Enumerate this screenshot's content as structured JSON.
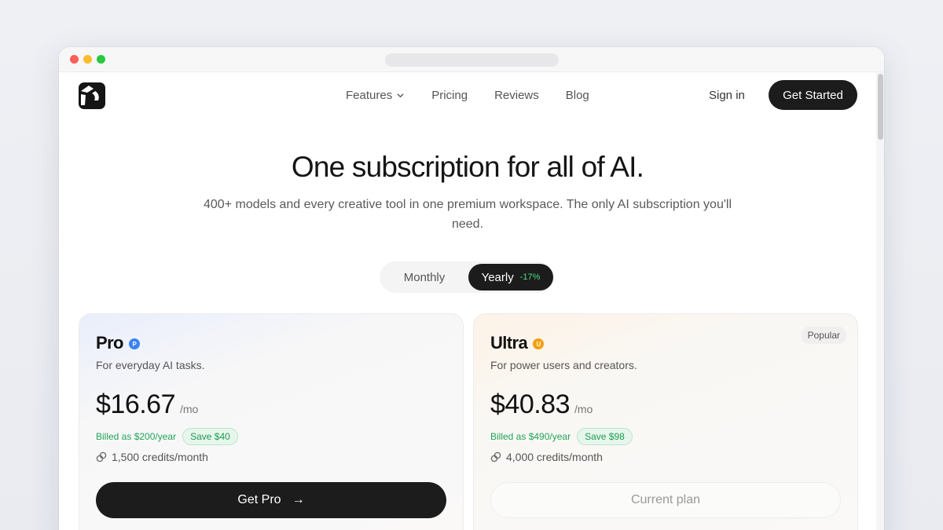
{
  "nav": {
    "links": [
      {
        "label": "Features"
      },
      {
        "label": "Pricing"
      },
      {
        "label": "Reviews"
      },
      {
        "label": "Blog"
      }
    ],
    "sign_in": "Sign in",
    "get_started": "Get Started"
  },
  "hero": {
    "title": "One subscription for all of AI.",
    "subtitle": "400+ models and every creative tool in one premium workspace. The only AI subscription you'll need."
  },
  "billing_toggle": {
    "monthly": "Monthly",
    "yearly": "Yearly",
    "yearly_discount": "-17%",
    "selected": "Yearly"
  },
  "plans": {
    "pro": {
      "name": "Pro",
      "badge_letter": "P",
      "description": "For everyday AI tasks.",
      "price": "$16.67",
      "unit": "/mo",
      "billed": "Billed as $200/year",
      "save": "Save $40",
      "credits": "1,500 credits/month",
      "cta": "Get Pro",
      "cta_arrow": "→"
    },
    "ultra": {
      "name": "Ultra",
      "badge_letter": "U",
      "description": "For power users and creators.",
      "price": "$40.83",
      "unit": "/mo",
      "billed": "Billed as $490/year",
      "save": "Save $98",
      "credits": "4,000 credits/month",
      "cta": "Current plan",
      "tag": "Popular"
    }
  },
  "colors": {
    "primary_dark": "#1c1c1c",
    "savings_green": "#22a35a",
    "pro_badge": "#3b82f6",
    "ultra_badge": "#f59e0b"
  }
}
